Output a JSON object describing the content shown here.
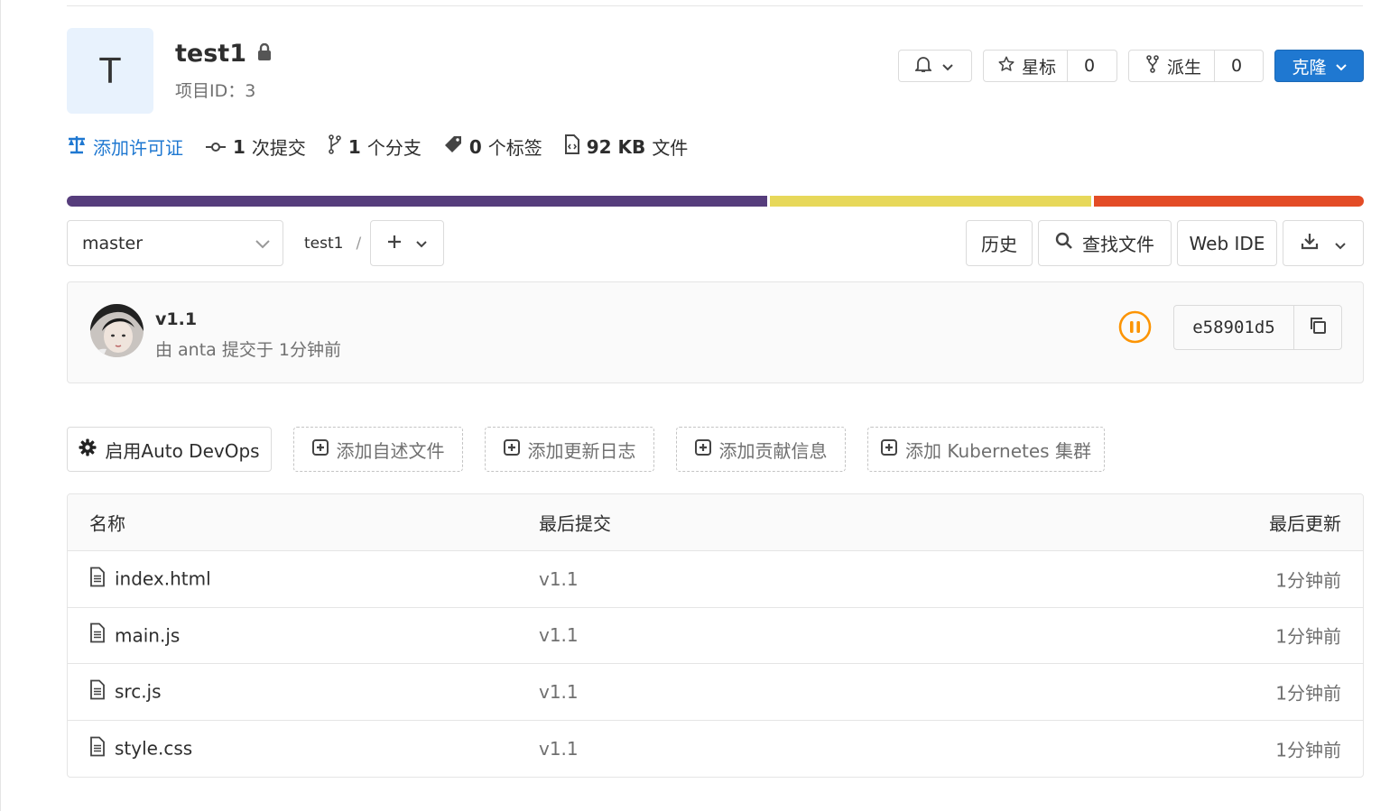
{
  "project": {
    "avatar_letter": "T",
    "name": "test1",
    "id_label": "项目ID：3"
  },
  "header_actions": {
    "star_label": "星标",
    "star_count": "0",
    "fork_label": "派生",
    "fork_count": "0",
    "clone_label": "克隆"
  },
  "stats": {
    "license": "添加许可证",
    "commits_num": "1",
    "commits_label": "次提交",
    "branches_num": "1",
    "branches_label": "个分支",
    "tags_num": "0",
    "tags_label": "个标签",
    "size_num": "92 KB",
    "size_label": "文件"
  },
  "language_bar": [
    {
      "color": "#563d7c",
      "fraction": 0.54
    },
    {
      "color": "#e7d85a",
      "fraction": 0.25
    },
    {
      "color": "#e34c26",
      "fraction": 0.21
    }
  ],
  "toolbar": {
    "branch": "master",
    "path": "test1",
    "path_sep": "/",
    "history": "历史",
    "find_file": "查找文件",
    "web_ide": "Web IDE"
  },
  "commit": {
    "title": "v1.1",
    "meta": "由 anta 提交于 1分钟前",
    "sha": "e58901d5",
    "pipeline_status": "paused"
  },
  "shortcuts": {
    "auto_devops": "启用Auto DevOps",
    "add_readme": "添加自述文件",
    "add_changelog": "添加更新日志",
    "add_contributing": "添加贡献信息",
    "add_k8s": "添加 Kubernetes 集群"
  },
  "table": {
    "headers": {
      "name": "名称",
      "last_commit": "最后提交",
      "last_update": "最后更新"
    },
    "rows": [
      {
        "name": "index.html",
        "commit": "v1.1",
        "updated": "1分钟前"
      },
      {
        "name": "main.js",
        "commit": "v1.1",
        "updated": "1分钟前"
      },
      {
        "name": "src.js",
        "commit": "v1.1",
        "updated": "1分钟前"
      },
      {
        "name": "style.css",
        "commit": "v1.1",
        "updated": "1分钟前"
      }
    ]
  }
}
